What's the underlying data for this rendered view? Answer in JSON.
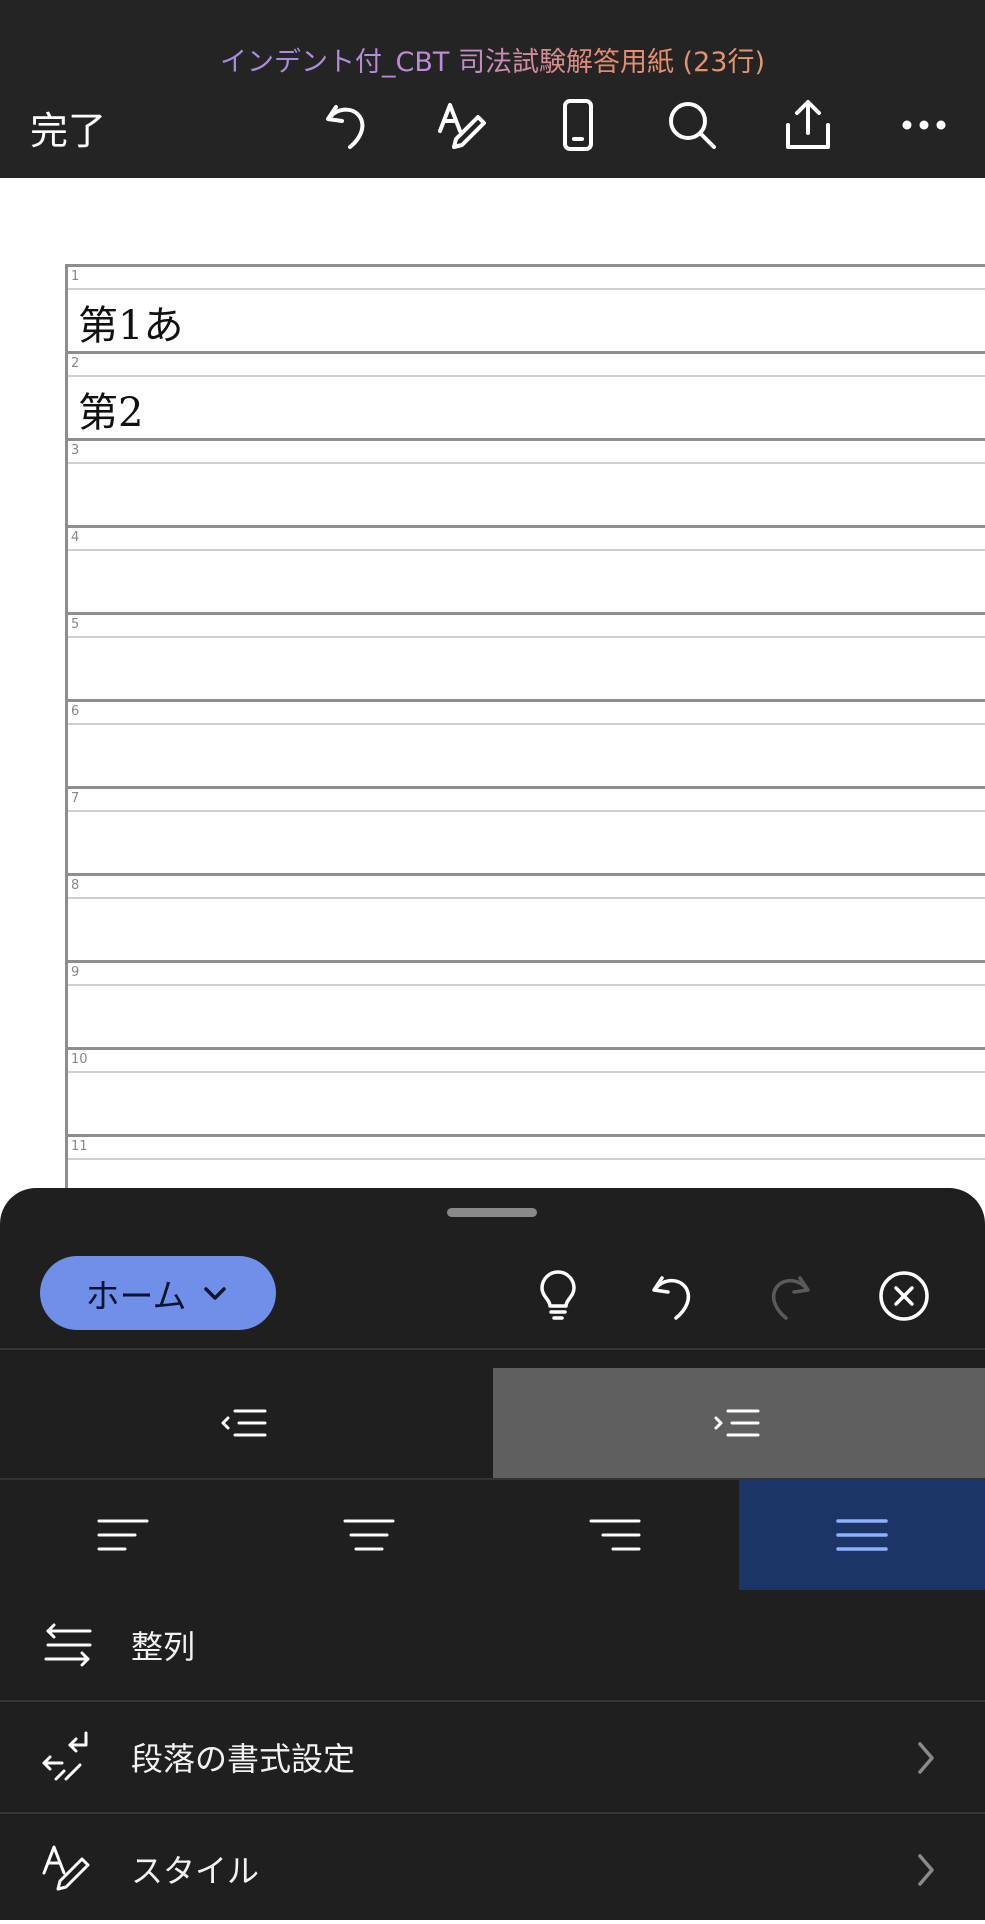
{
  "header": {
    "title": "インデント付_CBT 司法試験解答用紙 (23行)",
    "done_label": "完了",
    "icons": [
      "undo-icon",
      "draw-icon",
      "mobile-view-icon",
      "search-icon",
      "share-icon",
      "more-icon"
    ]
  },
  "document": {
    "rows": [
      {
        "num": "1",
        "text": "第1あ"
      },
      {
        "num": "2",
        "text": "第2"
      },
      {
        "num": "3",
        "text": ""
      },
      {
        "num": "4",
        "text": ""
      },
      {
        "num": "5",
        "text": ""
      },
      {
        "num": "6",
        "text": ""
      },
      {
        "num": "7",
        "text": ""
      },
      {
        "num": "8",
        "text": ""
      },
      {
        "num": "9",
        "text": ""
      },
      {
        "num": "10",
        "text": ""
      },
      {
        "num": "11",
        "text": ""
      }
    ]
  },
  "panel": {
    "tab_label": "ホーム",
    "icons": [
      "lightbulb-icon",
      "undo-icon",
      "redo-icon",
      "close-circle-icon"
    ],
    "indent": {
      "decrease": "decrease-indent-icon",
      "increase": "increase-indent-icon",
      "active": "increase"
    },
    "alignment": {
      "options": [
        "left",
        "center",
        "right",
        "justify"
      ],
      "active": "justify"
    },
    "menu": [
      {
        "label": "整列",
        "icon": "arrange-icon",
        "chevron": false
      },
      {
        "label": "段落の書式設定",
        "icon": "paragraph-format-icon",
        "chevron": true
      },
      {
        "label": "スタイル",
        "icon": "style-icon",
        "chevron": true
      }
    ],
    "colors": {
      "accent": "#6f8fe8",
      "active_align": "#1b3566",
      "active_indent": "#5f5f5f",
      "panel_bg": "#1f1f1f"
    }
  }
}
